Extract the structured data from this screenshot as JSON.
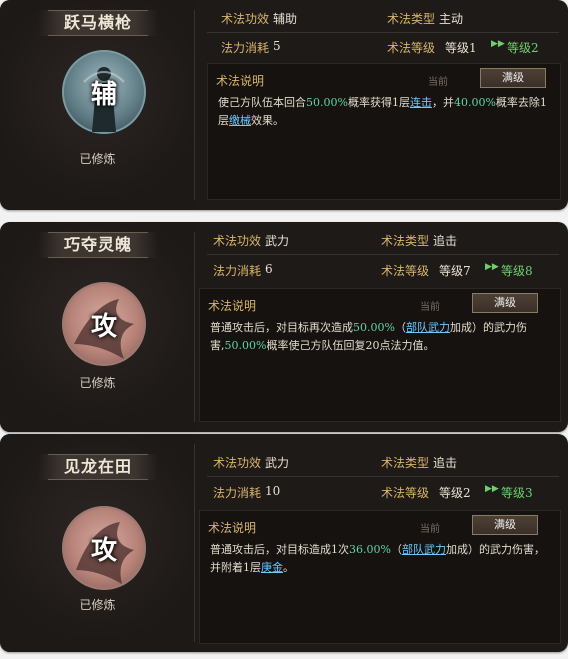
{
  "labels": {
    "effect": "术法功效",
    "type": "术法类型",
    "cost": "法力消耗",
    "level": "术法等级",
    "desc": "术法说明",
    "current": "当前",
    "max_btn": "满级",
    "learned": "已修炼"
  },
  "cards": [
    {
      "name": "跃马横枪",
      "icon_char": "辅",
      "effect": "辅助",
      "type": "主动",
      "cost": "5",
      "level_cur": "等级1",
      "level_next": "等级2",
      "desc": {
        "t1": "使己方队伍本回合",
        "v1": "50.00%",
        "t2": "概率获得1层",
        "k1": "连击",
        "t3": "，并",
        "v2": "40.00%",
        "t4": "概率去除1层",
        "k2": "缴械",
        "t5": "效果。"
      }
    },
    {
      "name": "巧夺灵魄",
      "icon_char": "攻",
      "effect": "武力",
      "type": "追击",
      "cost": "6",
      "level_cur": "等级7",
      "level_next": "等级8",
      "desc": {
        "t1": "普通攻击后，对目标再次造成",
        "v1": "50.00%",
        "t2": "（",
        "k1": "部队武力",
        "t3": "加成）的武力伤害,",
        "v2": "50.00%",
        "t4": "概率使己方队伍回复20点法力值。"
      }
    },
    {
      "name": "见龙在田",
      "icon_char": "攻",
      "effect": "武力",
      "type": "追击",
      "cost": "10",
      "level_cur": "等级2",
      "level_next": "等级3",
      "desc": {
        "t1": "普通攻击后，对目标造成1次",
        "v1": "36.00%",
        "t2": "（",
        "k1": "部队武力",
        "t3": "加成）的武力伤害，并附着1层",
        "k2": "庚金",
        "t4": "。"
      }
    }
  ]
}
